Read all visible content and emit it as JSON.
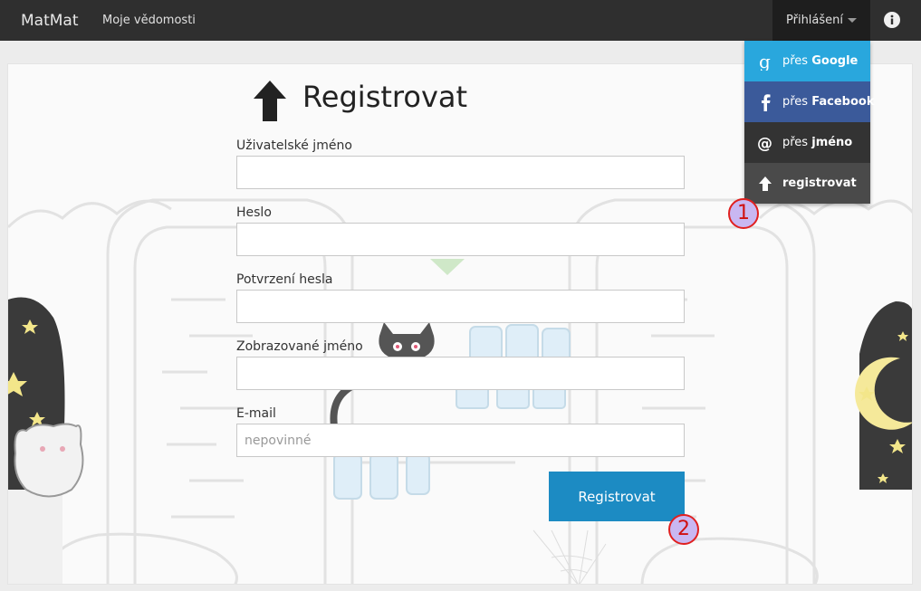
{
  "navbar": {
    "brand": "MatMat",
    "link_knowledge": "Moje vědomosti",
    "login_label": "Přihlášení",
    "info_icon": "info-icon"
  },
  "login_menu": {
    "items": [
      {
        "prefix": "přes",
        "strong": "Google",
        "icon": "google-icon",
        "color": "#29a7dd"
      },
      {
        "prefix": "přes",
        "strong": "Facebook",
        "icon": "facebook-icon",
        "color": "#3b5a9a"
      },
      {
        "prefix": "přes",
        "strong": "jméno",
        "icon": "at-icon",
        "color": "#333333"
      },
      {
        "prefix": "",
        "strong": "registrovat",
        "icon": "up-arrow-icon",
        "color": "#4a4a4a"
      }
    ]
  },
  "form": {
    "title": "Registrovat",
    "title_icon": "up-arrow-icon",
    "fields": [
      {
        "label": "Uživatelské jméno",
        "value": "",
        "placeholder": ""
      },
      {
        "label": "Heslo",
        "value": "",
        "placeholder": ""
      },
      {
        "label": "Potvrzení hesla",
        "value": "",
        "placeholder": ""
      },
      {
        "label": "Zobrazované jméno",
        "value": "",
        "placeholder": ""
      },
      {
        "label": "E-mail",
        "value": "",
        "placeholder": "nepovinné"
      }
    ],
    "submit_label": "Registrovat"
  },
  "annotations": {
    "marker_1": "1",
    "marker_2": "2"
  },
  "colors": {
    "navbar": "#2f2f2f",
    "primary_button": "#1c8bc3",
    "marker_border": "#e02020",
    "marker_fill": "#c9b7f2"
  }
}
